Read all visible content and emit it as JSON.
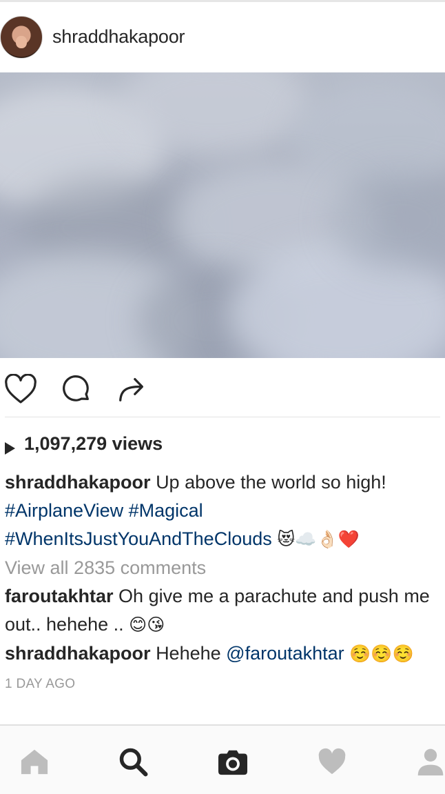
{
  "post": {
    "username": "shraddhakapoor",
    "views_text": "1,097,279 views",
    "caption": {
      "username": "shraddhakapoor",
      "text": "Up above the world so high!",
      "hashtags_line1": "#AirplaneView #Magical",
      "hashtag_line2": "#WhenItsJustYouAndTheClouds",
      "emojis": "😻☁️👌🏻❤️"
    },
    "view_all_comments": "View all 2835 comments",
    "comments": [
      {
        "username": "faroutakhtar",
        "text": "Oh give me a parachute and push me out.. hehehe ..",
        "emoji": "😊😘"
      },
      {
        "username": "shraddhakapoor",
        "text": "Hehehe",
        "mention": "@faroutakhtar",
        "emoji": "☺️☺️☺️"
      }
    ],
    "timestamp": "1 DAY AGO"
  },
  "icons": {
    "like": "heart-outline-icon",
    "comment": "comment-bubble-icon",
    "share": "share-arrow-icon",
    "nav": [
      "home-icon",
      "search-icon",
      "camera-icon",
      "heart-icon",
      "profile-icon"
    ]
  },
  "colors": {
    "text": "#262626",
    "hashtag": "#003569",
    "muted": "#999999",
    "icon_inactive": "#bdbdbd"
  }
}
